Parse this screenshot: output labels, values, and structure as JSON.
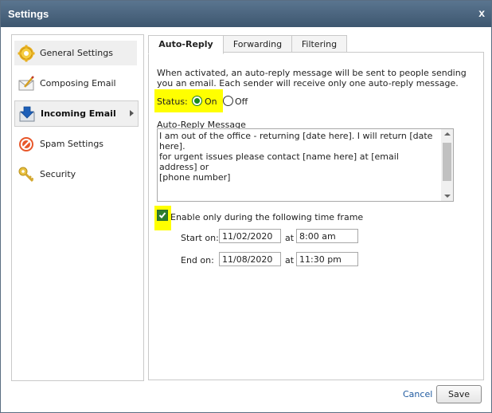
{
  "window": {
    "title": "Settings",
    "close_label": "x"
  },
  "sidebar": {
    "items": [
      {
        "label": "General Settings",
        "icon": "gear-icon"
      },
      {
        "label": "Composing Email",
        "icon": "compose-icon"
      },
      {
        "label": "Incoming Email",
        "icon": "incoming-icon",
        "selected": true
      },
      {
        "label": "Spam Settings",
        "icon": "no-entry-icon"
      },
      {
        "label": "Security",
        "icon": "key-icon"
      }
    ]
  },
  "tabs": [
    {
      "label": "Auto-Reply",
      "active": true
    },
    {
      "label": "Forwarding"
    },
    {
      "label": "Filtering"
    }
  ],
  "autoreply": {
    "intro": "When activated, an auto-reply message will be sent to people sending you an email. Each sender will receive only one auto-reply message.",
    "status_label": "Status:",
    "status_on": "On",
    "status_off": "Off",
    "status_value": "On",
    "message_label": "Auto-Reply Message",
    "message": "I am out of the office - returning [date here]. I will return [date here].\nfor urgent issues please contact [name here] at [email address] or\n[phone number]",
    "timeframe_label": "Enable only during the following time frame",
    "timeframe_enabled": true,
    "start_label": "Start on:",
    "end_label": "End on:",
    "at_label": "at",
    "start_date": "11/02/2020",
    "start_time": "8:00 am",
    "end_date": "11/08/2020",
    "end_time": "11:30 pm"
  },
  "footer": {
    "cancel_label": "Cancel",
    "save_label": "Save"
  },
  "colors": {
    "titlebar": "#46607a",
    "highlight": "#ffff00",
    "radio_on": "#1a8a1a",
    "link": "#1f5aa0"
  }
}
